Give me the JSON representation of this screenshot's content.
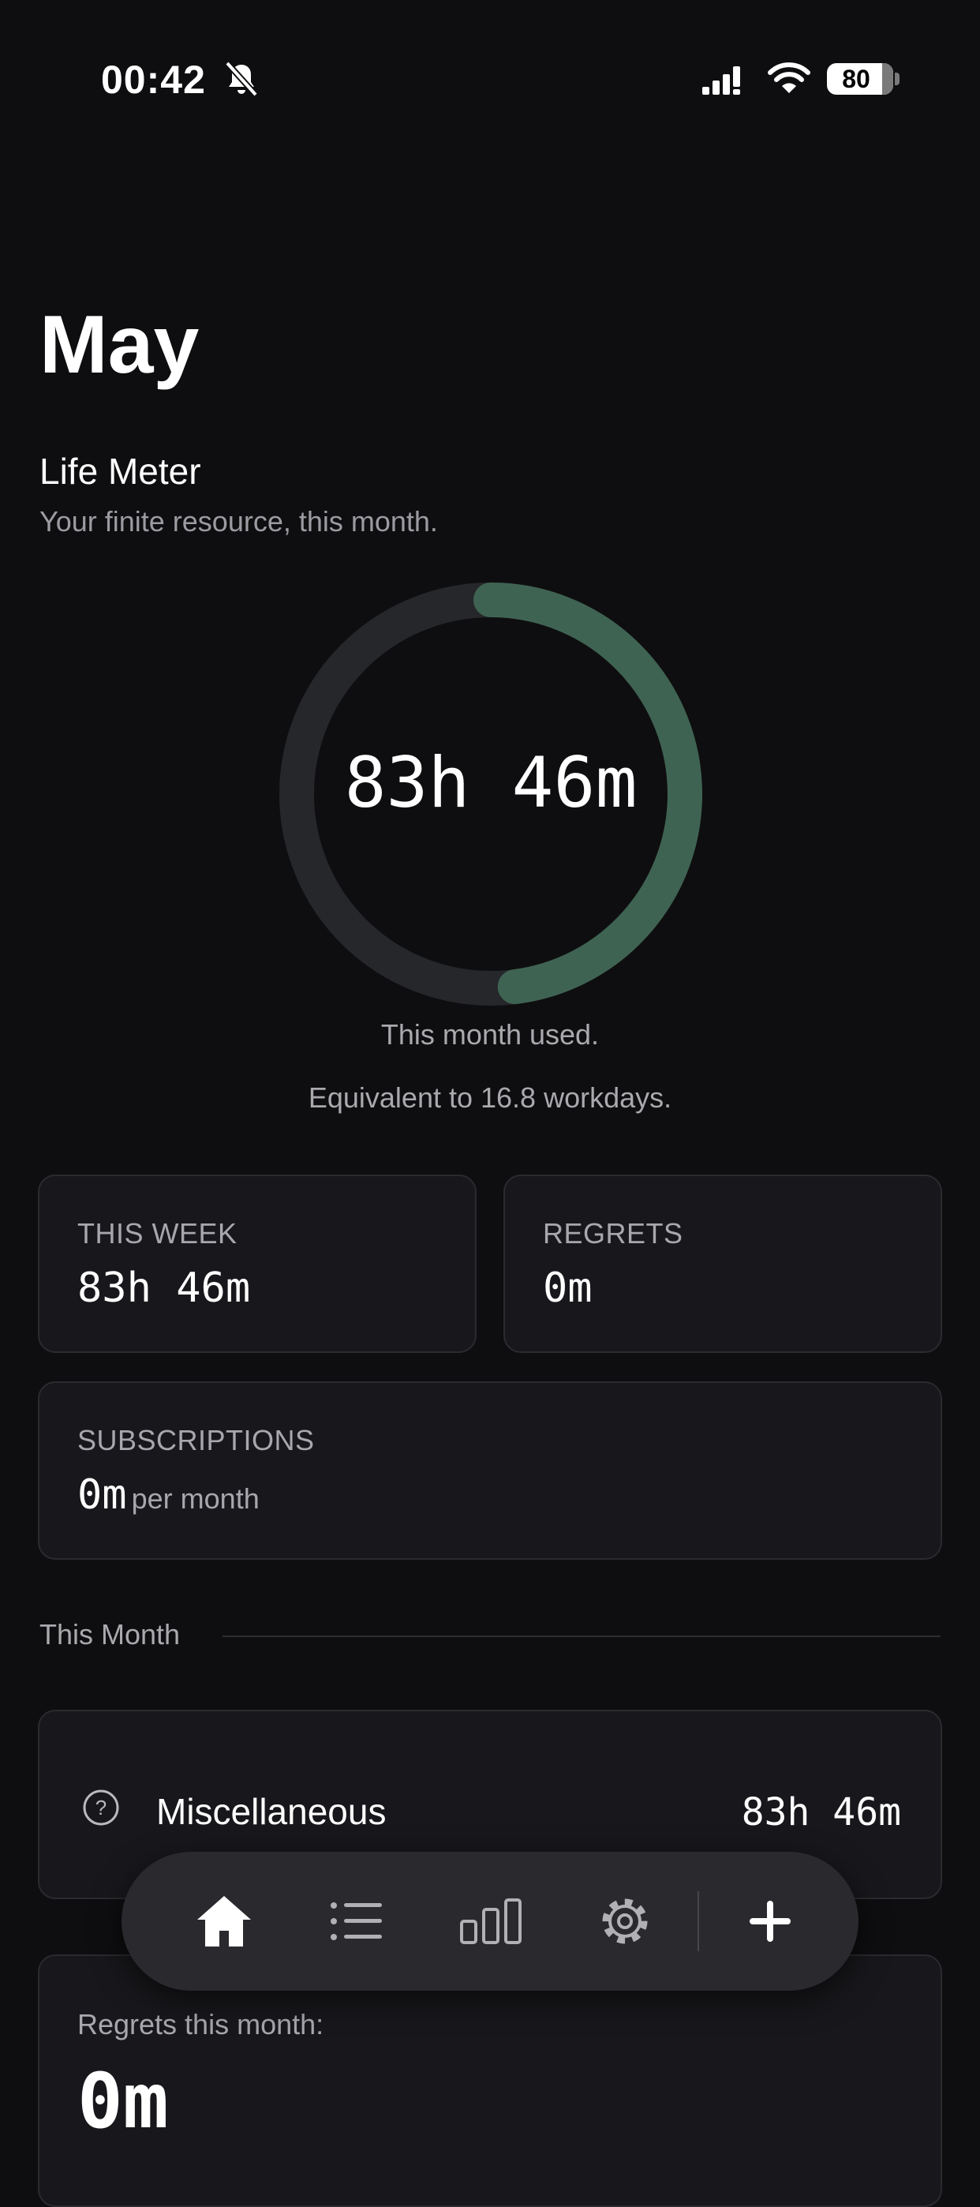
{
  "status_bar": {
    "time": "00:42",
    "battery": "80"
  },
  "header": {
    "title": "May"
  },
  "life_meter": {
    "title": "Life Meter",
    "subtitle": "Your finite resource, this month.",
    "value": "83h 46m",
    "progress": 0.48,
    "caption": "This month used.",
    "equivalent": "Equivalent to 16.8 workdays.",
    "track_color": "#26272b",
    "progress_color": "#3f6352"
  },
  "stats": {
    "this_week": {
      "label": "THIS WEEK",
      "value": "83h 46m"
    },
    "regrets": {
      "label": "REGRETS",
      "value": "0m"
    },
    "subscriptions": {
      "label": "SUBSCRIPTIONS",
      "value": "0m",
      "unit": "per month"
    }
  },
  "this_month": {
    "label": "This Month",
    "categories": [
      {
        "icon": "question-circle-icon",
        "name": "Miscellaneous",
        "time": "83h 46m"
      }
    ]
  },
  "regrets_month": {
    "label": "Regrets this month:",
    "value": "0m"
  },
  "tabbar": {
    "items": [
      {
        "icon": "home-icon",
        "active": true
      },
      {
        "icon": "list-icon",
        "active": false
      },
      {
        "icon": "bar-chart-icon",
        "active": false
      },
      {
        "icon": "gear-icon",
        "active": false
      },
      {
        "icon": "plus-icon",
        "active": false
      }
    ]
  }
}
